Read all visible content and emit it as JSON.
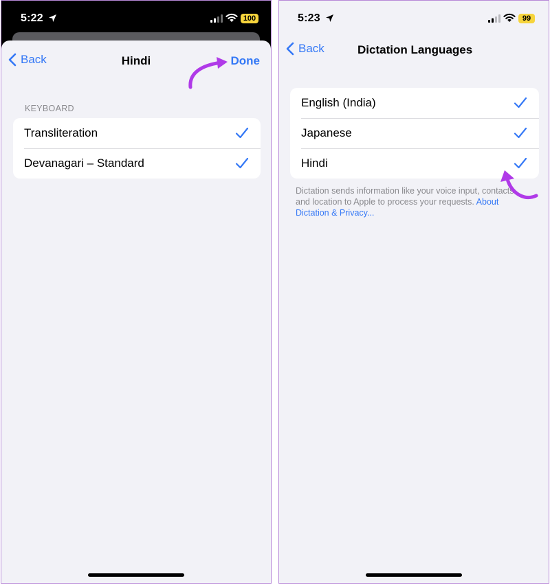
{
  "colors": {
    "accent": "#3478f6",
    "annotation": "#b03ae8",
    "battery_fill": "#f6d43c",
    "grouped_background": "#f2f2f7"
  },
  "left": {
    "status": {
      "time": "5:22",
      "battery": "100"
    },
    "nav": {
      "back_label": "Back",
      "title": "Hindi",
      "done_label": "Done"
    },
    "section_header": "KEYBOARD",
    "rows": [
      {
        "label": "Transliteration",
        "checked": true,
        "icon": "checkmark-icon"
      },
      {
        "label": "Devanagari – Standard",
        "checked": true,
        "icon": "checkmark-icon"
      }
    ]
  },
  "right": {
    "status": {
      "time": "5:23",
      "battery": "99"
    },
    "nav": {
      "back_label": "Back",
      "title": "Dictation Languages"
    },
    "rows": [
      {
        "label": "English (India)",
        "checked": true,
        "icon": "checkmark-icon"
      },
      {
        "label": "Japanese",
        "checked": true,
        "icon": "checkmark-icon"
      },
      {
        "label": "Hindi",
        "checked": true,
        "icon": "checkmark-icon"
      }
    ],
    "footer": {
      "text": "Dictation sends information like your voice input, contacts and location to Apple to process your requests. ",
      "link": "About Dictation & Privacy..."
    }
  }
}
